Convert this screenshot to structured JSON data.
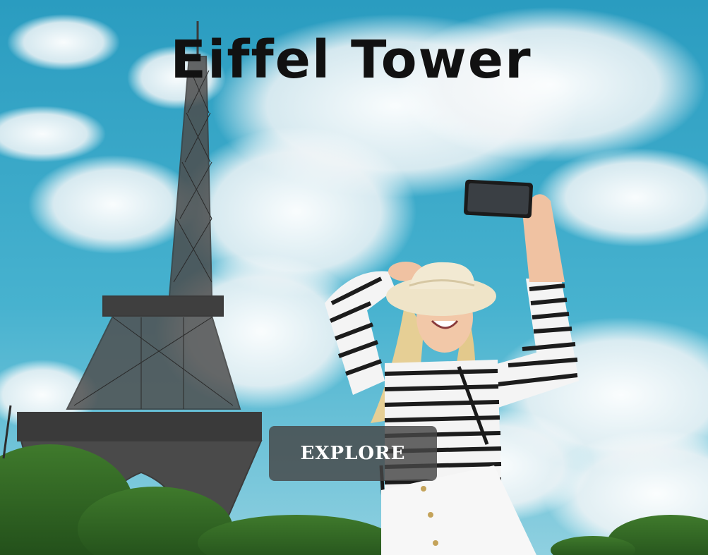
{
  "hero": {
    "title": "Eiffel Tower",
    "button_label": "EXPLORE"
  },
  "colors": {
    "sky": "#2f9fbf",
    "title_text": "#111111",
    "button_bg": "#464646",
    "button_text": "#ffffff"
  }
}
